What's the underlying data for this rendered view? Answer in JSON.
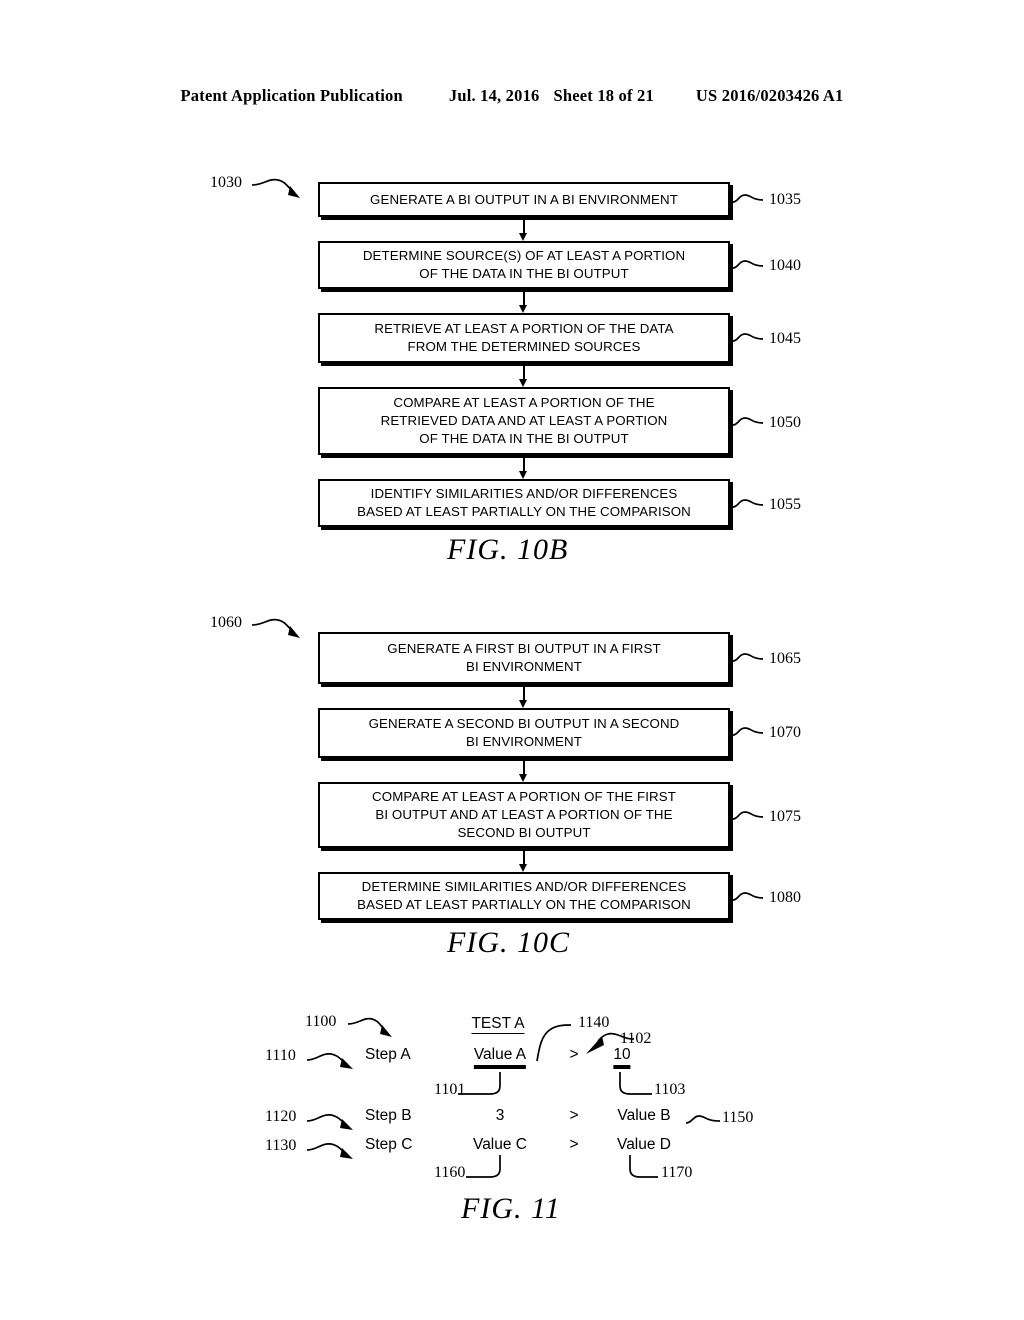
{
  "header": {
    "left": "Patent Application Publication",
    "date": "Jul. 14, 2016",
    "sheet": "Sheet 18 of 21",
    "number": "US 2016/0203426 A1"
  },
  "fig10b": {
    "caption": "FIG. 10B",
    "flow_ref": "1030",
    "steps": [
      {
        "ref": "1035",
        "lines": [
          "GENERATE A BI OUTPUT IN A BI ENVIRONMENT"
        ]
      },
      {
        "ref": "1040",
        "lines": [
          "DETERMINE SOURCE(S) OF AT LEAST A PORTION",
          "OF THE DATA IN THE BI OUTPUT"
        ]
      },
      {
        "ref": "1045",
        "lines": [
          "RETRIEVE AT LEAST A PORTION OF THE DATA",
          "FROM THE DETERMINED SOURCES"
        ]
      },
      {
        "ref": "1050",
        "lines": [
          "COMPARE AT LEAST A PORTION OF THE",
          "RETRIEVED DATA AND AT LEAST A PORTION",
          "OF THE DATA IN THE BI OUTPUT"
        ]
      },
      {
        "ref": "1055",
        "lines": [
          "IDENTIFY SIMILARITIES AND/OR DIFFERENCES",
          "BASED AT LEAST PARTIALLY ON THE COMPARISON"
        ]
      }
    ]
  },
  "fig10c": {
    "caption": "FIG. 10C",
    "flow_ref": "1060",
    "steps": [
      {
        "ref": "1065",
        "lines": [
          "GENERATE A FIRST BI OUTPUT IN A FIRST",
          "BI ENVIRONMENT"
        ]
      },
      {
        "ref": "1070",
        "lines": [
          "GENERATE A SECOND BI OUTPUT IN A SECOND",
          "BI ENVIRONMENT"
        ]
      },
      {
        "ref": "1075",
        "lines": [
          "COMPARE AT LEAST A PORTION OF THE FIRST",
          "BI OUTPUT AND AT LEAST A PORTION OF THE",
          "SECOND BI OUTPUT"
        ]
      },
      {
        "ref": "1080",
        "lines": [
          "DETERMINE SIMILARITIES AND/OR DIFFERENCES",
          "BASED AT LEAST PARTIALLY ON THE COMPARISON"
        ]
      }
    ]
  },
  "fig11": {
    "caption": "FIG. 11",
    "table_ref": "1100",
    "header_label": "TEST A",
    "rows": [
      {
        "step_ref": "1110",
        "step": "Step A",
        "left": "Value A",
        "op": ">",
        "right": "10"
      },
      {
        "step_ref": "1120",
        "step": "Step B",
        "left": "3",
        "op": ">",
        "right": "Value B"
      },
      {
        "step_ref": "1130",
        "step": "Step C",
        "left": "Value C",
        "op": ">",
        "right": "Value D"
      }
    ],
    "refs": {
      "test_header": "1140",
      "left_value_a": "1101",
      "operator": "1102",
      "right_value_10": "1103",
      "value_b": "1150",
      "value_c": "1160",
      "value_d": "1170"
    }
  }
}
